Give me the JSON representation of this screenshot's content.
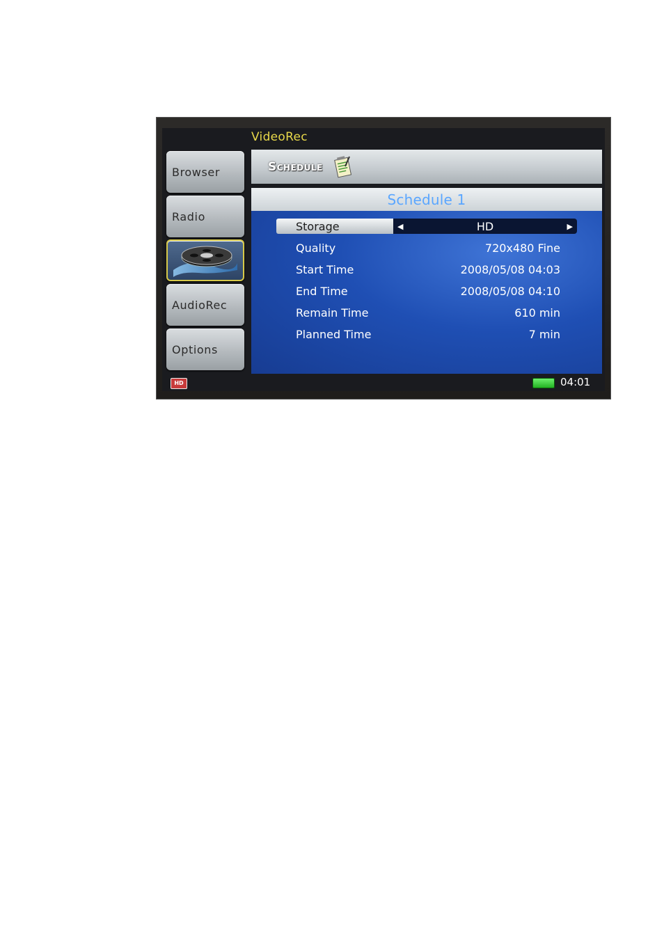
{
  "app": {
    "title": "VideoRec"
  },
  "sidebar": {
    "items": [
      {
        "label": "Browser"
      },
      {
        "label": "Radio"
      },
      {
        "label": "",
        "icon": "film-reel-icon",
        "active": true
      },
      {
        "label": "AudioRec"
      },
      {
        "label": "Options"
      }
    ]
  },
  "header": {
    "title": "Schedule",
    "icon": "schedule-notepad-icon"
  },
  "schedule": {
    "title": "Schedule 1",
    "storage": {
      "label": "Storage",
      "value": "HD"
    },
    "rows": [
      {
        "label": "Quality",
        "value": "720x480 Fine"
      },
      {
        "label": "Start Time",
        "value": "2008/05/08 04:03"
      },
      {
        "label": "End Time",
        "value": "2008/05/08 04:10"
      },
      {
        "label": "Remain Time",
        "value": "610 min"
      },
      {
        "label": "Planned Time",
        "value": "7 min"
      }
    ]
  },
  "status": {
    "hd_badge": "HD",
    "clock": "04:01",
    "battery_color": "#3cd43c"
  },
  "colors": {
    "title_accent": "#e8d84a",
    "schedule_title": "#5aa6ff",
    "content_blue": "#1f4fb4"
  }
}
